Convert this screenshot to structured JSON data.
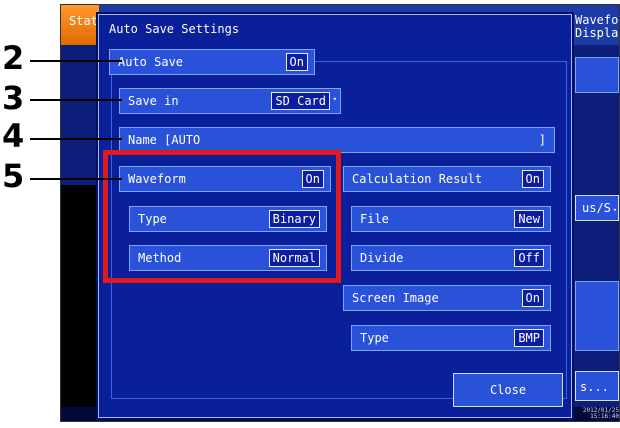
{
  "background": {
    "tab_start": "Stat",
    "tab_waveform": "Waveform\nDisplay",
    "sample_rate_select": "us/S",
    "more_button": "s...",
    "clock_date": "2012/01/25",
    "clock_time": "15:16:40"
  },
  "dialog": {
    "title": "Auto Save Settings",
    "rows": {
      "auto_save": {
        "label": "Auto Save",
        "value": "On"
      },
      "save_in": {
        "label": "Save in",
        "value": "SD Card"
      },
      "name": {
        "label": "Name [AUTO",
        "end": "]"
      },
      "waveform": {
        "label": "Waveform",
        "value": "On"
      },
      "type": {
        "label": "Type",
        "value": "Binary"
      },
      "method": {
        "label": "Method",
        "value": "Normal"
      },
      "calc_result": {
        "label": "Calculation Result",
        "value": "On"
      },
      "file": {
        "label": "File",
        "value": "New"
      },
      "divide": {
        "label": "Divide",
        "value": "Off"
      },
      "screen_image": {
        "label": "Screen Image",
        "value": "On"
      },
      "image_type": {
        "label": "Type",
        "value": "BMP"
      }
    },
    "close_label": "Close"
  },
  "callouts": [
    "2",
    "3",
    "4",
    "5"
  ],
  "colors": {
    "dialog_bg": "#0a1f9a",
    "row_bg": "#2a52d8",
    "accent_tab": "#f08a1c",
    "highlight": "#e01a1a"
  }
}
